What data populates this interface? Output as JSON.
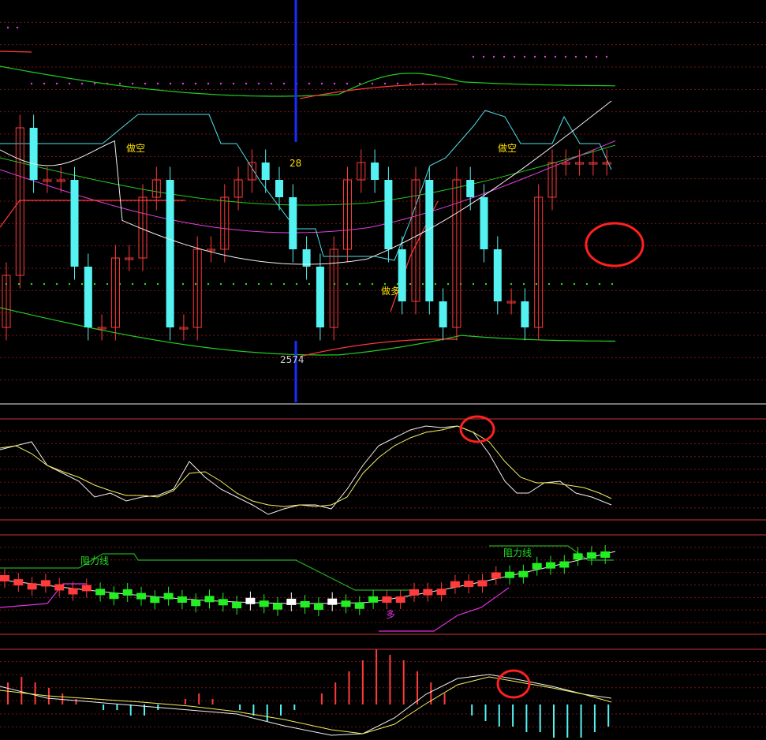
{
  "colors": {
    "background": "#000000",
    "up": "#ff3b3b",
    "down": "#55f2f2",
    "green_bright": "#22ee22",
    "grid": "#7a1414",
    "separator": "#d23232",
    "upper_band": "#22cc22",
    "mid_band": "#b8e000",
    "ma_white": "#f0f0f0",
    "ma_magenta": "#e040e0",
    "stop_line": "#4ee0e8",
    "blue_marker": "#1a2cff",
    "label_yellow": "#ffe000",
    "label_green": "#22dd22",
    "label_magenta": "#e030e0",
    "circle": "#ff2020",
    "dots_magenta": "#e040e0",
    "dots_green": "#22dd22"
  },
  "panels": {
    "main": {
      "labels": {
        "short_left": "做空",
        "short_right": "做空",
        "long": "做多",
        "high_value": "28",
        "low_value": "2574"
      }
    },
    "kdj": {},
    "trend": {
      "labels": {
        "resistance_left": "阻力线",
        "resistance_right": "阻力线",
        "long": "多"
      }
    },
    "macd": {}
  },
  "chart_data": [
    {
      "type": "candlestick",
      "panel": "main",
      "x": [
        1,
        2,
        3,
        4,
        5,
        6,
        7,
        8,
        9,
        10,
        11,
        12,
        13,
        14,
        15,
        16,
        17,
        18,
        19,
        20,
        21,
        22,
        23,
        24,
        25,
        26,
        27,
        28,
        29,
        30,
        31,
        32,
        33,
        34,
        35,
        36,
        37,
        38,
        39,
        40,
        41,
        42,
        43,
        44,
        45
      ],
      "open": [
        5,
        11,
        28,
        22,
        22,
        22,
        12,
        5,
        5,
        13,
        13,
        20,
        22,
        5,
        5,
        14,
        14,
        20,
        22,
        24,
        22,
        20,
        14,
        12,
        5,
        14,
        22,
        24,
        22,
        14,
        8,
        22,
        8,
        5,
        22,
        20,
        14,
        8,
        8,
        5,
        20,
        24,
        24,
        24,
        24
      ],
      "close": [
        11,
        28,
        22,
        22,
        22,
        12,
        5,
        5,
        13,
        13,
        20,
        22,
        5,
        5,
        14,
        14,
        20,
        22,
        24,
        22,
        20,
        14,
        12,
        5,
        14,
        22,
        24,
        22,
        14,
        8,
        22,
        8,
        5,
        22,
        20,
        14,
        8,
        8,
        5,
        20,
        24,
        24,
        24,
        24,
        24
      ],
      "high": [
        6,
        12,
        29,
        22,
        23,
        23,
        13,
        6,
        6,
        14,
        14,
        21,
        23,
        6,
        6,
        15,
        15,
        21,
        23,
        25,
        23,
        21,
        15,
        13,
        6,
        15,
        23,
        25,
        23,
        15,
        9,
        23,
        9,
        6,
        23,
        21,
        15,
        9,
        9,
        6,
        21,
        25,
        25,
        25,
        25
      ],
      "low": [
        4,
        10,
        27,
        21,
        21,
        21,
        11,
        4,
        4,
        12,
        12,
        19,
        21,
        4,
        4,
        13,
        13,
        19,
        21,
        23,
        21,
        19,
        13,
        11,
        4,
        13,
        21,
        23,
        21,
        13,
        7,
        21,
        7,
        4,
        21,
        19,
        13,
        7,
        7,
        4,
        19,
        23,
        23,
        23,
        23
      ],
      "annotations": [
        "做空",
        "做空",
        "做多",
        "28",
        "2574"
      ]
    },
    {
      "type": "line",
      "panel": "kdj",
      "x": [
        1,
        2,
        3,
        4,
        5,
        6,
        7,
        8,
        9,
        10,
        11,
        12,
        13,
        14,
        15,
        16,
        17,
        18,
        19,
        20,
        21,
        22,
        23,
        24,
        25,
        26,
        27,
        28,
        29,
        30,
        31,
        32,
        33,
        34,
        35,
        36,
        37,
        38,
        39,
        40,
        41,
        42,
        43,
        44,
        45
      ],
      "series": [
        {
          "values": [
            70,
            72,
            78,
            65,
            55,
            58,
            50,
            48,
            45,
            42,
            38,
            40,
            45,
            35,
            30,
            32,
            34,
            36,
            30,
            28,
            32,
            35,
            50,
            62,
            70,
            65,
            58,
            52,
            45,
            40,
            34,
            30,
            28,
            30,
            25,
            28,
            32,
            38,
            45,
            52,
            64,
            74,
            82,
            92,
            98
          ]
        },
        {
          "values": [
            68,
            70,
            74,
            68,
            60,
            58,
            54,
            50,
            47,
            44,
            41,
            40,
            42,
            38,
            34,
            33,
            34,
            35,
            33,
            31,
            32,
            34,
            44,
            55,
            63,
            64,
            61,
            56,
            50,
            45,
            39,
            35,
            32,
            31,
            29,
            29,
            31,
            35,
            41,
            48,
            58,
            67,
            76,
            85,
            92
          ]
        }
      ]
    },
    {
      "type": "candlestick",
      "panel": "trend",
      "x": [
        1,
        2,
        3,
        4,
        5,
        6,
        7,
        8,
        9,
        10,
        11,
        12,
        13,
        14,
        15,
        16,
        17,
        18,
        19,
        20,
        21,
        22,
        23,
        24,
        25,
        26,
        27,
        28,
        29,
        30,
        31,
        32,
        33,
        34,
        35,
        36,
        37,
        38,
        39,
        40,
        41,
        42,
        43,
        44,
        45
      ],
      "series": [
        {
          "values": [
            5,
            6,
            5,
            4,
            3,
            2,
            2,
            1,
            2,
            3,
            4,
            5,
            4,
            3,
            3,
            4,
            5,
            6,
            5,
            4,
            3,
            2,
            2,
            3,
            4,
            5,
            5,
            4,
            3,
            2,
            3,
            2,
            1,
            2,
            3,
            3,
            4,
            5,
            6,
            5,
            4,
            3,
            4,
            5,
            6
          ]
        }
      ],
      "annotations": [
        "阻力线",
        "阻力线",
        "多"
      ]
    },
    {
      "type": "bar",
      "panel": "macd",
      "x": [
        1,
        2,
        3,
        4,
        5,
        6,
        7,
        8,
        9,
        10,
        11,
        12,
        13,
        14,
        15,
        16,
        17,
        18,
        19,
        20,
        21,
        22,
        23,
        24,
        25,
        26,
        27,
        28,
        29,
        30,
        31,
        32,
        33,
        34,
        35,
        36,
        37,
        38,
        39,
        40,
        41,
        42,
        43,
        44,
        45
      ],
      "values": [
        4,
        5,
        4,
        3,
        2,
        1,
        0,
        -1,
        -1,
        -2,
        -2,
        -1,
        0,
        1,
        2,
        1,
        0,
        -1,
        -2,
        -3,
        -2,
        -1,
        0,
        2,
        4,
        6,
        8,
        10,
        9,
        8,
        6,
        4,
        2,
        0,
        -2,
        -3,
        -4,
        -4,
        -5,
        -5,
        -6,
        -6,
        -6,
        -5,
        -4
      ],
      "series": [
        {
          "values": [
            3,
            4,
            4,
            4,
            3,
            3,
            2,
            1,
            0,
            -1,
            -1,
            -1,
            -1,
            -1,
            0,
            0,
            0,
            -1,
            -1,
            -2,
            -2,
            -2,
            -1,
            0,
            1,
            2,
            4,
            6,
            7,
            8,
            8,
            7,
            6,
            5,
            3,
            2,
            1,
            0,
            -1,
            -2,
            -3,
            -3,
            -4,
            -4,
            -4
          ]
        },
        {
          "values": [
            2,
            3,
            3,
            3,
            3,
            3,
            2,
            2,
            1,
            1,
            0,
            0,
            0,
            0,
            0,
            0,
            0,
            0,
            0,
            -1,
            -1,
            -1,
            -1,
            -1,
            0,
            1,
            2,
            3,
            5,
            6,
            6,
            6,
            6,
            5,
            4,
            3,
            2,
            1,
            0,
            -1,
            -1,
            -2,
            -2,
            -3,
            -3
          ]
        }
      ]
    }
  ]
}
